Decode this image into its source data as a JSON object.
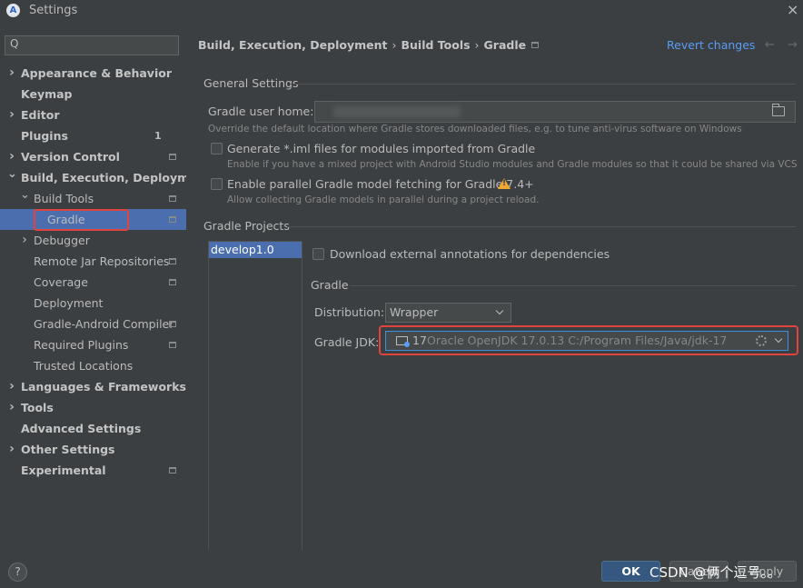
{
  "window": {
    "title": "Settings",
    "app_icon": "android-studio-icon"
  },
  "sidebar": {
    "search_placeholder": "Q",
    "items": [
      {
        "label": "Appearance & Behavior",
        "bold": true,
        "expander": "right"
      },
      {
        "label": "Keymap",
        "bold": true
      },
      {
        "label": "Editor",
        "bold": true,
        "expander": "right"
      },
      {
        "label": "Plugins",
        "bold": true,
        "badge": "1"
      },
      {
        "label": "Version Control",
        "bold": true,
        "expander": "right",
        "modified": true
      },
      {
        "label": "Build, Execution, Deployment",
        "bold": true,
        "expander": "down"
      },
      {
        "label": "Build Tools",
        "expander": "down",
        "modified": true
      },
      {
        "label": "Gradle",
        "selected": true,
        "modified": true
      },
      {
        "label": "Debugger",
        "expander": "right"
      },
      {
        "label": "Remote Jar Repositories",
        "modified": true
      },
      {
        "label": "Coverage",
        "modified": true
      },
      {
        "label": "Deployment"
      },
      {
        "label": "Gradle-Android Compiler",
        "modified": true
      },
      {
        "label": "Required Plugins",
        "modified": true
      },
      {
        "label": "Trusted Locations"
      },
      {
        "label": "Languages & Frameworks",
        "bold": true,
        "expander": "right"
      },
      {
        "label": "Tools",
        "bold": true,
        "expander": "right"
      },
      {
        "label": "Advanced Settings",
        "bold": true
      },
      {
        "label": "Other Settings",
        "bold": true,
        "expander": "right"
      },
      {
        "label": "Experimental",
        "bold": true,
        "modified": true
      }
    ]
  },
  "header": {
    "breadcrumb": [
      "Build, Execution, Deployment",
      "Build Tools",
      "Gradle"
    ],
    "revert": "Revert changes",
    "back_arrow": "←",
    "forward_arrow": "→"
  },
  "general": {
    "title": "General Settings",
    "user_home_label": "Gradle user home:",
    "user_home_hint": "Override the default location where Gradle stores downloaded files, e.g. to tune anti-virus software on Windows",
    "iml_label": "Generate *.iml files for modules imported from Gradle",
    "iml_hint": "Enable if you have a mixed project with Android Studio modules and Gradle modules so that it could be shared via VCS",
    "parallel_label": "Enable parallel Gradle model fetching for Gradle 7.4+",
    "parallel_hint": "Allow collecting Gradle models in parallel during a project reload."
  },
  "projects": {
    "title": "Gradle Projects",
    "list": [
      "develop1.0"
    ],
    "download_annotations_label": "Download external annotations for dependencies",
    "gradle_title": "Gradle",
    "distribution_label": "Distribution:",
    "distribution_value": "Wrapper",
    "jdk_label": "Gradle JDK:",
    "jdk_version": "17",
    "jdk_path": "Oracle OpenJDK 17.0.13 C:/Program Files/Java/jdk-17"
  },
  "footer": {
    "help": "?",
    "ok": "OK",
    "cancel": "Cancel",
    "apply": "Apply",
    "watermark": "CSDN @俩个逗号。。"
  },
  "colors": {
    "background": "#3c3f41",
    "selection": "#4b6eaf",
    "link": "#589df6",
    "highlight_box": "#e0443e",
    "warning": "#f0a732"
  }
}
